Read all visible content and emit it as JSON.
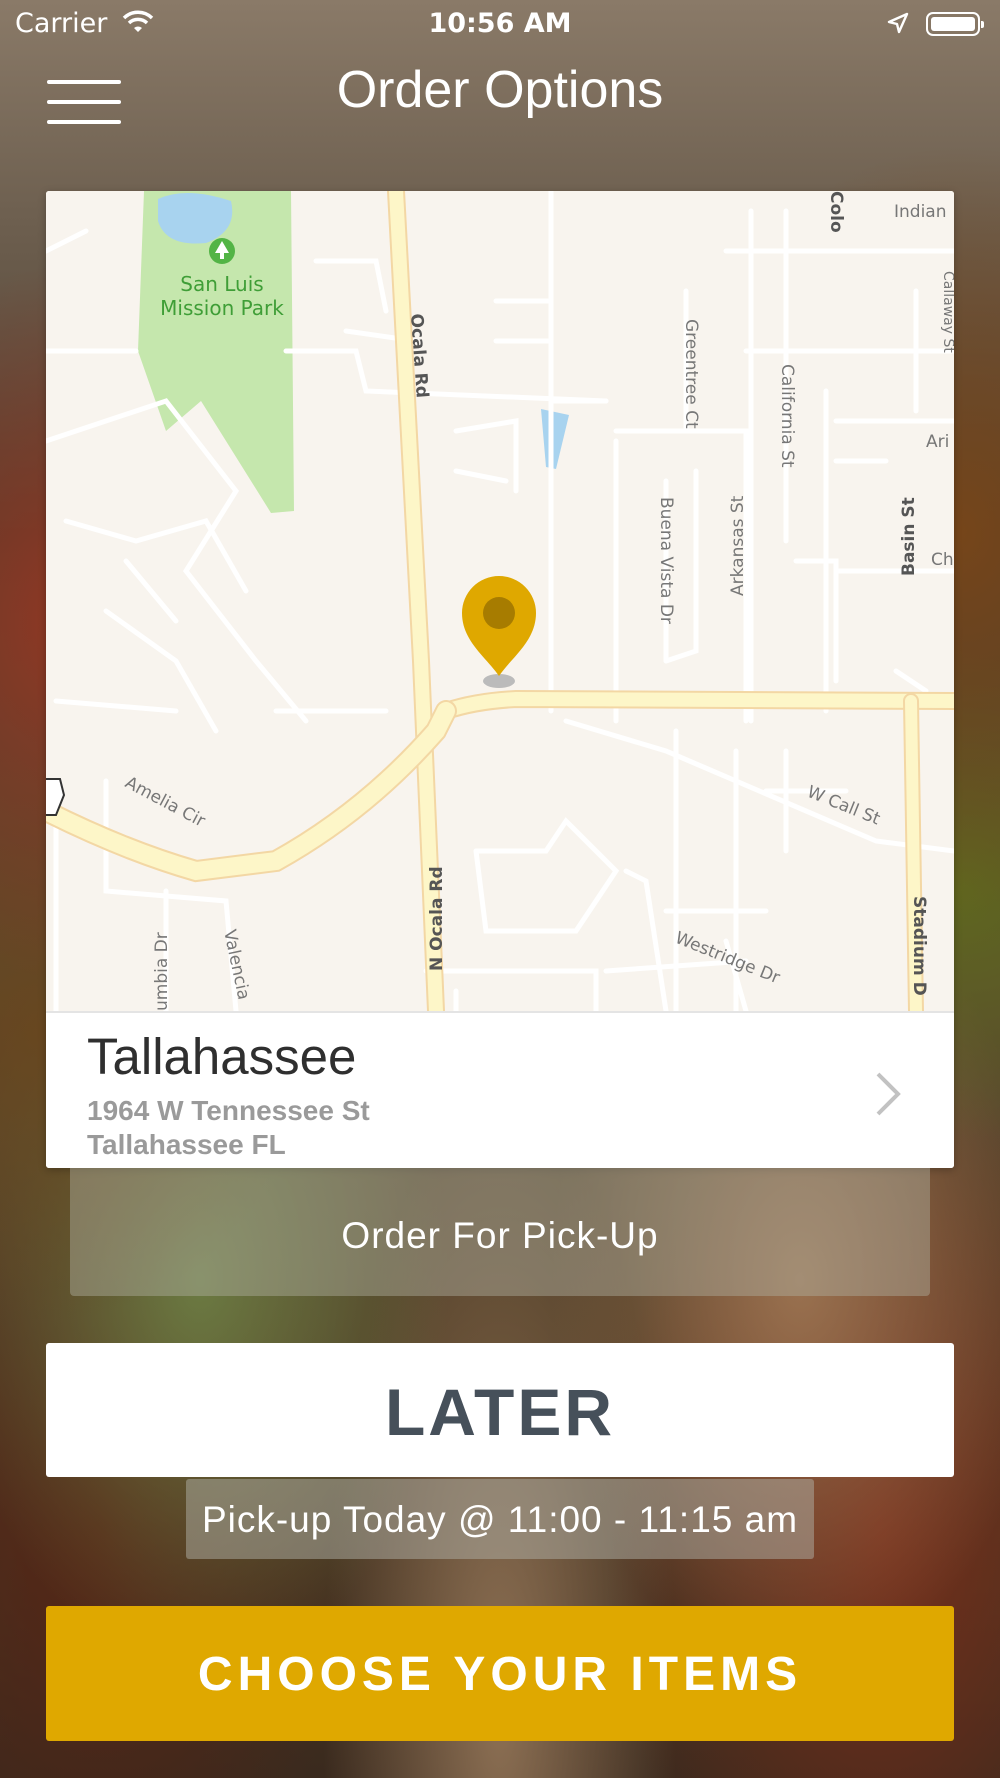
{
  "status_bar": {
    "carrier": "Carrier",
    "time": "10:56 AM"
  },
  "header": {
    "title": "Order Options",
    "menu_icon": "hamburger-menu-icon"
  },
  "map": {
    "park_label_line1": "San Luis",
    "park_label_line2": "Mission Park",
    "street_labels": {
      "ocala_rd": "Ocala Rd",
      "n_ocala_rd": "N Ocala Rd",
      "greentree_ct": "Greentree Ct",
      "california_st": "California St",
      "arkansas_st": "Arkansas St",
      "buena_vista_dr": "Buena Vista Dr",
      "basin_st": "Basin St",
      "w_call_st": "W Call St",
      "amelia_cir": "Amelia Cir",
      "westridge_dr": "Westridge Dr",
      "stadium_dr": "Stadium D",
      "valencia": "Valencia",
      "columbia_dr": "umbia Dr",
      "indian": "Indian",
      "colo": "Colo",
      "ari": "Ari",
      "ch": "Ch",
      "callaway": "Callaway St"
    },
    "pin_color": "#dfa800"
  },
  "location": {
    "name": "Tallahassee",
    "address_line1": "1964 W  Tennessee St",
    "address_line2": "Tallahassee FL",
    "chevron_icon": "chevron-right-icon"
  },
  "order_mode": {
    "label": "Order For Pick-Up"
  },
  "timing": {
    "later_label": "LATER",
    "pickup_time": "Pick-up Today @ 11:00 - 11:15 am"
  },
  "cta": {
    "label": "CHOOSE YOUR ITEMS",
    "color": "#dfa800"
  }
}
